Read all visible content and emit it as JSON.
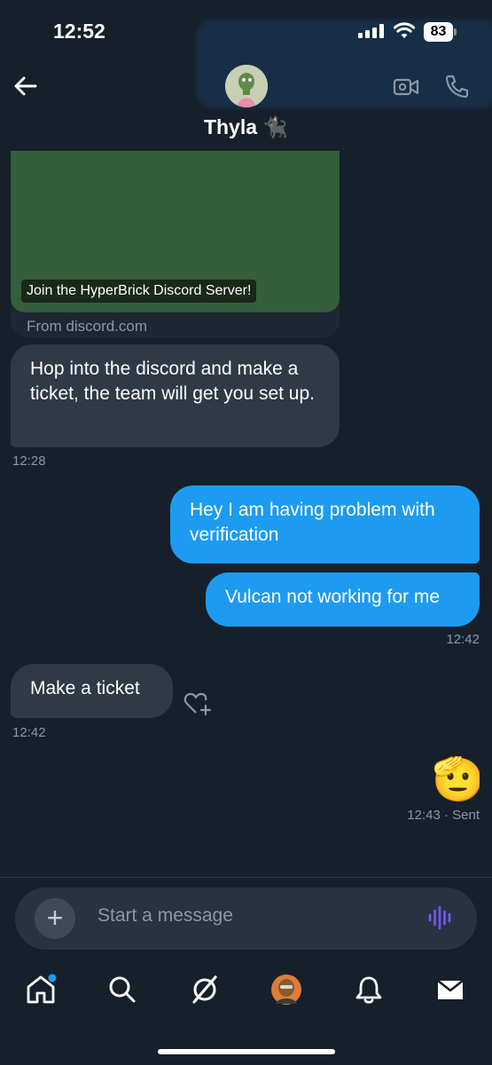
{
  "status": {
    "time": "12:52",
    "battery": "83"
  },
  "header": {
    "contact_name": "Thyla 🐈‍⬛"
  },
  "link_card": {
    "caption": "Join the HyperBrick Discord Server!",
    "domain": "From discord.com"
  },
  "messages": [
    {
      "direction": "in",
      "text": "Hop into the discord and make a ticket, the team will get you set up.",
      "time": "12:28"
    },
    {
      "direction": "out",
      "text": "Hey I am having problem with verification"
    },
    {
      "direction": "out",
      "text": "Vulcan not working for me",
      "time": "12:42"
    },
    {
      "direction": "in",
      "text": "Make a ticket",
      "time": "12:42"
    },
    {
      "direction": "out",
      "text": "🫡",
      "time": "12:43 · Sent"
    }
  ],
  "composer": {
    "placeholder": "Start a message"
  },
  "tabs": [
    {
      "icon": "home-icon",
      "has_badge": true
    },
    {
      "icon": "search-icon"
    },
    {
      "icon": "grok-icon"
    },
    {
      "icon": "profile-avatar-icon"
    },
    {
      "icon": "bell-icon"
    },
    {
      "icon": "mail-icon"
    }
  ],
  "colors": {
    "background": "#15202b",
    "accent": "#1d9bf0",
    "incoming_bubble": "#2f3a46",
    "link_image": "#355e3b"
  }
}
